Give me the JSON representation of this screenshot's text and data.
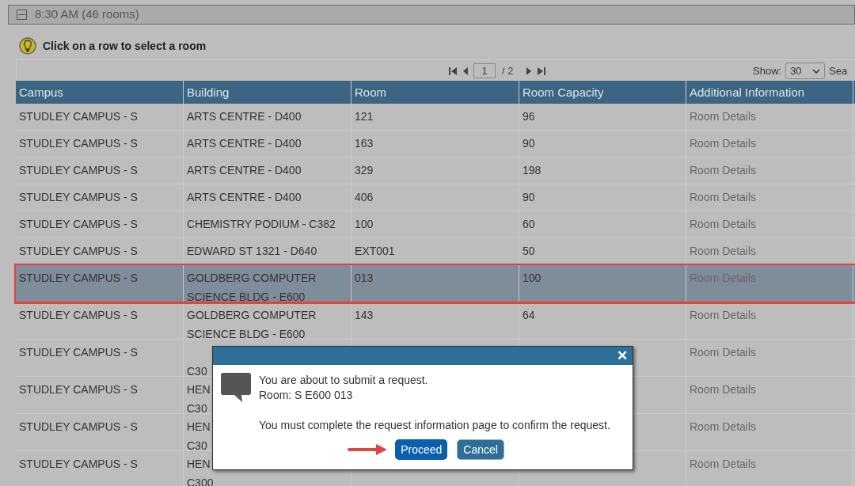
{
  "group_header": {
    "title": "8:30 AM (46 rooms)",
    "expanded": true
  },
  "hint": "Click on a row to select a room",
  "pager": {
    "page": "1",
    "total": "/ 2",
    "show_label": "Show:",
    "show_value": "30",
    "search_label": "Sea"
  },
  "table": {
    "columns": [
      "Campus",
      "Building",
      "Room",
      "Room Capacity",
      "Additional Information"
    ],
    "rows": [
      {
        "cells": [
          "STUDLEY CAMPUS - S",
          "ARTS CENTRE - D400",
          "121",
          "96",
          "Room Details"
        ],
        "selected": false
      },
      {
        "cells": [
          "STUDLEY CAMPUS - S",
          "ARTS CENTRE - D400",
          "163",
          "90",
          "Room Details"
        ],
        "selected": false
      },
      {
        "cells": [
          "STUDLEY CAMPUS - S",
          "ARTS CENTRE - D400",
          "329",
          "198",
          "Room Details"
        ],
        "selected": false
      },
      {
        "cells": [
          "STUDLEY CAMPUS - S",
          "ARTS CENTRE - D400",
          "406",
          "90",
          "Room Details"
        ],
        "selected": false
      },
      {
        "cells": [
          "STUDLEY CAMPUS - S",
          "CHEMISTRY PODIUM - C382",
          "100",
          "60",
          "Room Details"
        ],
        "selected": false
      },
      {
        "cells": [
          "STUDLEY CAMPUS - S",
          "EDWARD ST 1321 - D640",
          "EXT001",
          "50",
          "Room Details"
        ],
        "selected": false
      },
      {
        "cells": [
          "STUDLEY CAMPUS - S",
          "GOLDBERG COMPUTER\nSCIENCE BLDG - E600",
          "013",
          "100",
          "Room Details"
        ],
        "selected": true
      },
      {
        "cells": [
          "STUDLEY CAMPUS - S",
          "GOLDBERG COMPUTER\nSCIENCE BLDG - E600",
          "143",
          "64",
          "Room Details"
        ],
        "selected": false
      },
      {
        "cells": [
          "STUDLEY CAMPUS - S",
          "\nC30",
          "",
          "",
          "Room Details"
        ],
        "selected": false
      },
      {
        "cells": [
          "STUDLEY CAMPUS - S",
          "HEN\nC30",
          "",
          "",
          "Room Details"
        ],
        "selected": false
      },
      {
        "cells": [
          "STUDLEY CAMPUS - S",
          "HEN\nC30",
          "",
          "",
          "Room Details"
        ],
        "selected": false
      },
      {
        "cells": [
          "STUDLEY CAMPUS - S",
          "HEN\nC300",
          "",
          "",
          "Room Details"
        ],
        "selected": false
      }
    ]
  },
  "dialog": {
    "close": "✕",
    "lines": [
      "You are about to submit a request.",
      "Room: S E600 013"
    ],
    "note": "You must complete the request information page to confirm the request.",
    "buttons": [
      {
        "label": "Proceed",
        "kind": "primary"
      },
      {
        "label": "Cancel",
        "kind": "secondary"
      }
    ]
  }
}
